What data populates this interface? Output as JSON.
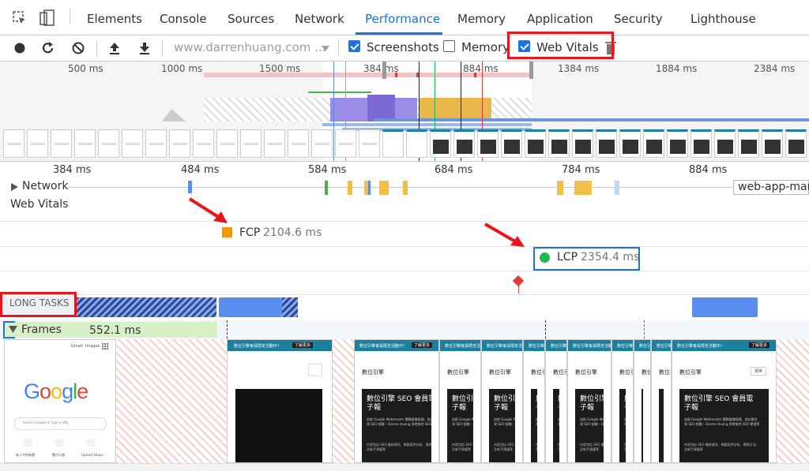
{
  "tabs": {
    "elements": "Elements",
    "console": "Console",
    "sources": "Sources",
    "network": "Network",
    "performance": "Performance",
    "memory": "Memory",
    "application": "Application",
    "security": "Security",
    "lighthouse": "Lighthouse"
  },
  "toolbar": {
    "url": "www.darrenhuang.com ...",
    "screenshots": {
      "label": "Screenshots",
      "checked": true
    },
    "memory": {
      "label": "Memory",
      "checked": false
    },
    "web_vitals": {
      "label": "Web Vitals",
      "checked": true
    }
  },
  "overview": {
    "ticks": [
      "500 ms",
      "1000 ms",
      "1500 ms",
      "384 ms",
      "884 ms",
      "1384 ms",
      "1884 ms",
      "2384 ms"
    ]
  },
  "timeline": {
    "ticks": [
      "384 ms",
      "484 ms",
      "584 ms",
      "684 ms",
      "784 ms",
      "884 ms"
    ],
    "network_label": "Network",
    "network_request": "web-app-man",
    "web_vitals_label": "Web Vitals",
    "fcp": {
      "label": "FCP",
      "value": "2104.6 ms",
      "color": "#f29900"
    },
    "lcp": {
      "label": "LCP",
      "value": "2354.4 ms",
      "color": "#1db954"
    },
    "long_tasks_label": "LONG TASKS",
    "frames_label": "Frames",
    "frames_time": "552.1 ms"
  },
  "frames": {
    "google_logo": "Google",
    "search_placeholder": "Search Google or type a URL",
    "header_links": [
      "Gmail",
      "Images"
    ],
    "shortcuts": [
      "新人中的新聞",
      "數位行銷",
      "Upload Stupo..."
    ],
    "banner_text": "數位引擎會員限定活動中！",
    "banner_button": "了解更多",
    "site_name": "數位引擎",
    "hero_title": "數位引擎 SEO 會員電子報",
    "hero_body": "由前 Google Webmaster 團隊基礎經理，前谷歌台灣 SEO 經驗 – Darren Huang 所帶來的 SEO 學習等",
    "hero_footer": "內容包括 SEO 最新資訊、網路案例分析、實際方法，及新手建議等",
    "nav_button": "選單"
  },
  "colors": {
    "accent": "#1a73e8",
    "annotation_red": "#e8161a",
    "lcp_box": "#1a73e8"
  }
}
